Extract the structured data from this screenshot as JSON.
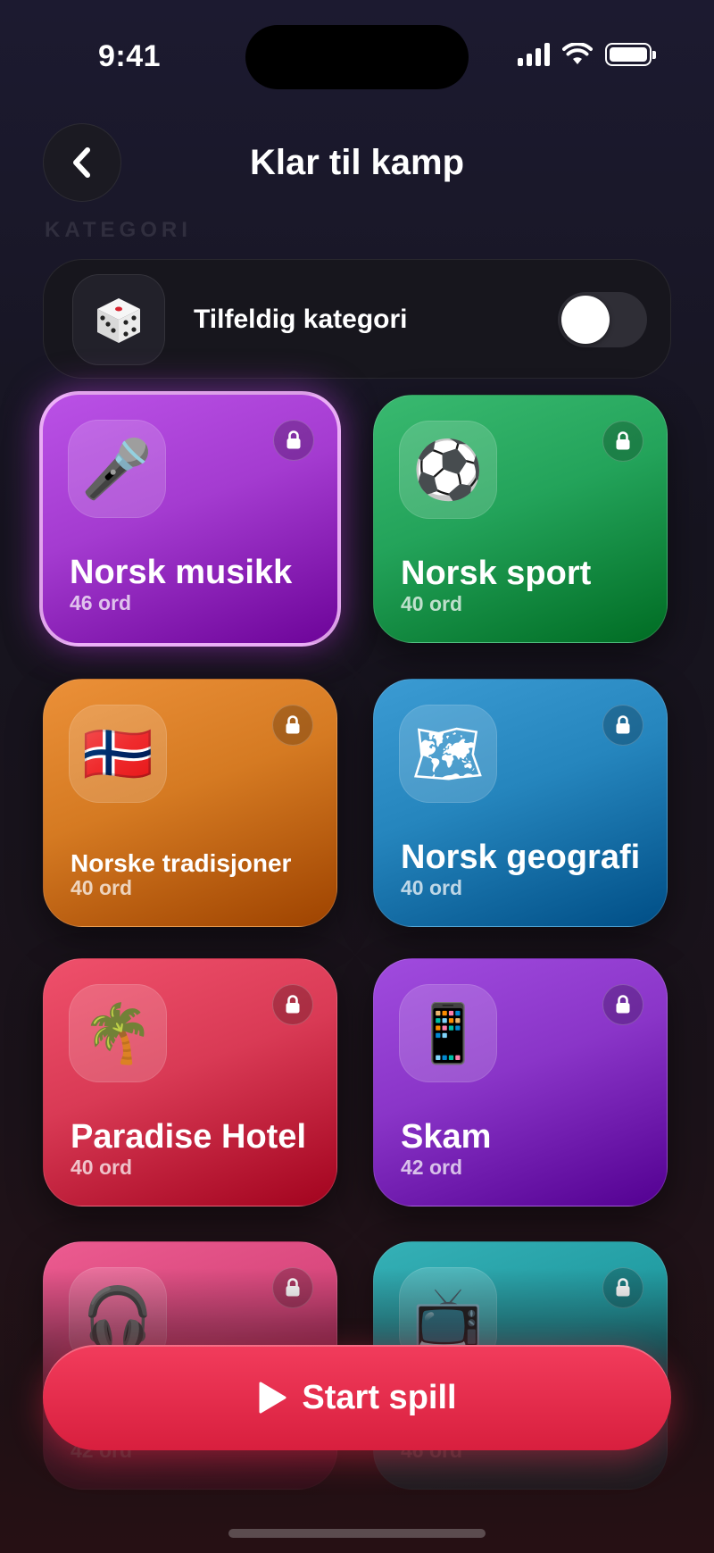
{
  "status_bar": {
    "time": "9:41"
  },
  "header": {
    "title": "Klar til kamp",
    "back_icon": "chevron-left-icon"
  },
  "section_label": "KATEGORI",
  "random_category": {
    "icon": "dice-icon",
    "label": "Tilfeldig kategori",
    "toggle_on": false
  },
  "categories": [
    {
      "title": "Norsk musikk",
      "count": "46 ord",
      "icon": "🎤",
      "icon_name": "microphone-icon",
      "color": "#a43bd0",
      "selected": true
    },
    {
      "title": "Norsk sport",
      "count": "40 ord",
      "icon": "⚽",
      "icon_name": "soccer-ball-icon",
      "color": "#23a35a",
      "selected": false
    },
    {
      "title": "Norske tradisjoner",
      "count": "40 ord",
      "icon": "🇳🇴",
      "icon_name": "norway-flag-icon",
      "color": "#d57a22",
      "selected": false
    },
    {
      "title": "Norsk geografi",
      "count": "40 ord",
      "icon": "🗺",
      "icon_name": "map-icon",
      "color": "#2585bd",
      "selected": false
    },
    {
      "title": "Paradise Hotel",
      "count": "40 ord",
      "icon": "🌴",
      "icon_name": "palm-tree-icon",
      "color": "#d93a55",
      "selected": false
    },
    {
      "title": "Skam",
      "count": "42 ord",
      "icon": "📱",
      "icon_name": "phone-icon",
      "color": "#8a35c8",
      "selected": false
    },
    {
      "title": "",
      "count": "42 ord",
      "icon": "🎧",
      "icon_name": "headphones-icon",
      "color": "#d6457a",
      "selected": false
    },
    {
      "title": "",
      "count": "46 ord",
      "icon": "📺",
      "icon_name": "tv-icon",
      "color": "#1f9aa0",
      "selected": false
    }
  ],
  "start_button": {
    "label": "Start spill",
    "icon": "play-icon"
  },
  "colors": {
    "accent": "#e8304f",
    "background": "#16141f"
  }
}
